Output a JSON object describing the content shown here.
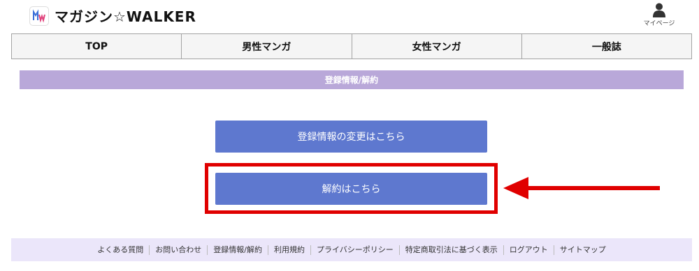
{
  "brand": {
    "name": "マガジン☆WALKER",
    "logo_letters": "MW"
  },
  "header": {
    "mypage_label": "マイページ",
    "mypage_icon": "user-icon"
  },
  "nav": {
    "items": [
      "TOP",
      "男性マンガ",
      "女性マンガ",
      "一般誌"
    ]
  },
  "section": {
    "title": "登録情報/解約"
  },
  "buttons": {
    "change_label": "登録情報の変更はこちら",
    "cancel_label": "解約はこちら"
  },
  "footer": {
    "links": [
      "よくある質問",
      "お問い合わせ",
      "登録情報/解約",
      "利用規約",
      "プライバシーポリシー",
      "特定商取引法に基づく表示",
      "ログアウト",
      "サイトマップ"
    ]
  },
  "colors": {
    "nav_bg": "#f5f5f5",
    "section_bar": "#b9a8d9",
    "button": "#5e78cf",
    "highlight": "#e00000",
    "footer_bg": "#ebe6fa"
  }
}
